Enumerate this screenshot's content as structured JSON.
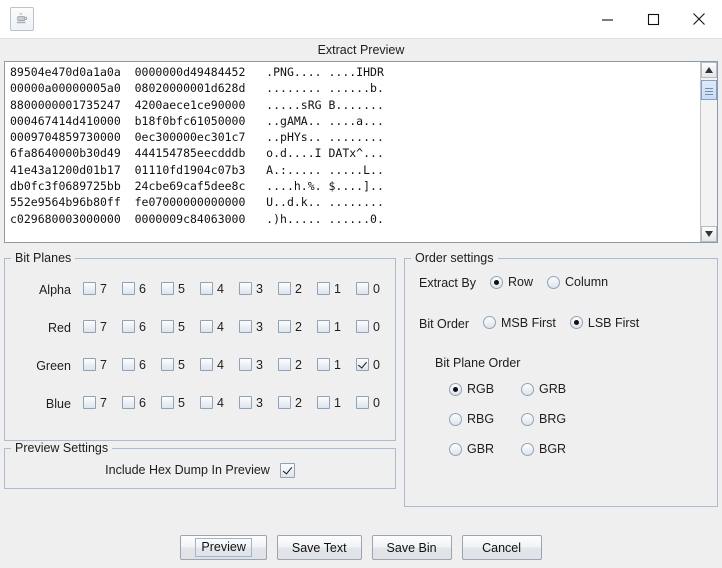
{
  "window": {
    "app_icon": "java-coffee-cup-icon",
    "title": "Extract Preview",
    "controls": {
      "minimize": "minimize-icon",
      "maximize": "maximize-icon",
      "close": "close-icon"
    }
  },
  "preview": {
    "lines": [
      "89504e470d0a1a0a  0000000d49484452   .PNG.... ....IHDR",
      "00000a00000005a0  08020000001d628d   ........ ......b.",
      "8800000001735247  4200aece1ce90000   .....sRG B.......",
      "000467414d410000  b18f0bfc61050000   ..gAMA.. ....a...",
      "0009704859730000  0ec300000ec301c7   ..pHYs.. ........",
      "6fa8640000b30d49  444154785eecdddb   o.d....I DATx^...",
      "41e43a1200d01b17  01110fd1904c07b3   A.:..... .....L..",
      "db0fc3f0689725bb  24cbe69caf5dee8c   ....h.%. $....]..",
      "552e9564b96b80ff  fe07000000000000   U..d.k.. ........",
      "c029680003000000  0000009c84063000   .)h..... ......0."
    ],
    "scrollbar": {
      "up_arrow": "scroll-up-arrow-icon",
      "down_arrow": "scroll-down-arrow-icon"
    }
  },
  "bit_planes": {
    "legend": "Bit Planes",
    "bits": [
      "7",
      "6",
      "5",
      "4",
      "3",
      "2",
      "1",
      "0"
    ],
    "channels": [
      {
        "label": "Alpha",
        "checked": [
          false,
          false,
          false,
          false,
          false,
          false,
          false,
          false
        ]
      },
      {
        "label": "Red",
        "checked": [
          false,
          false,
          false,
          false,
          false,
          false,
          false,
          false
        ]
      },
      {
        "label": "Green",
        "checked": [
          false,
          false,
          false,
          false,
          false,
          false,
          false,
          true
        ]
      },
      {
        "label": "Blue",
        "checked": [
          false,
          false,
          false,
          false,
          false,
          false,
          false,
          false
        ]
      }
    ]
  },
  "preview_settings": {
    "legend": "Preview Settings",
    "include_hex_dump_label": "Include Hex Dump In Preview",
    "include_hex_dump_checked": true
  },
  "order_settings": {
    "legend": "Order settings",
    "extract_by_label": "Extract By",
    "extract_by_options": [
      {
        "label": "Row",
        "selected": true
      },
      {
        "label": "Column",
        "selected": false
      }
    ],
    "bit_order_label": "Bit Order",
    "bit_order_options": [
      {
        "label": "MSB First",
        "selected": false
      },
      {
        "label": "LSB First",
        "selected": true
      }
    ],
    "bit_plane_order_label": "Bit Plane Order",
    "bit_plane_order_options": [
      {
        "label": "RGB",
        "selected": true
      },
      {
        "label": "GRB",
        "selected": false
      },
      {
        "label": "RBG",
        "selected": false
      },
      {
        "label": "BRG",
        "selected": false
      },
      {
        "label": "GBR",
        "selected": false
      },
      {
        "label": "BGR",
        "selected": false
      }
    ]
  },
  "footer": {
    "buttons": [
      {
        "label": "Preview",
        "focused": true
      },
      {
        "label": "Save Text",
        "focused": false
      },
      {
        "label": "Save Bin",
        "focused": false
      },
      {
        "label": "Cancel",
        "focused": false
      }
    ]
  },
  "colors": {
    "window_bg": "#efefef",
    "panel_border": "#a8bdd4",
    "text_area_bg": "#ffffff",
    "text": "#1d1d1d"
  }
}
